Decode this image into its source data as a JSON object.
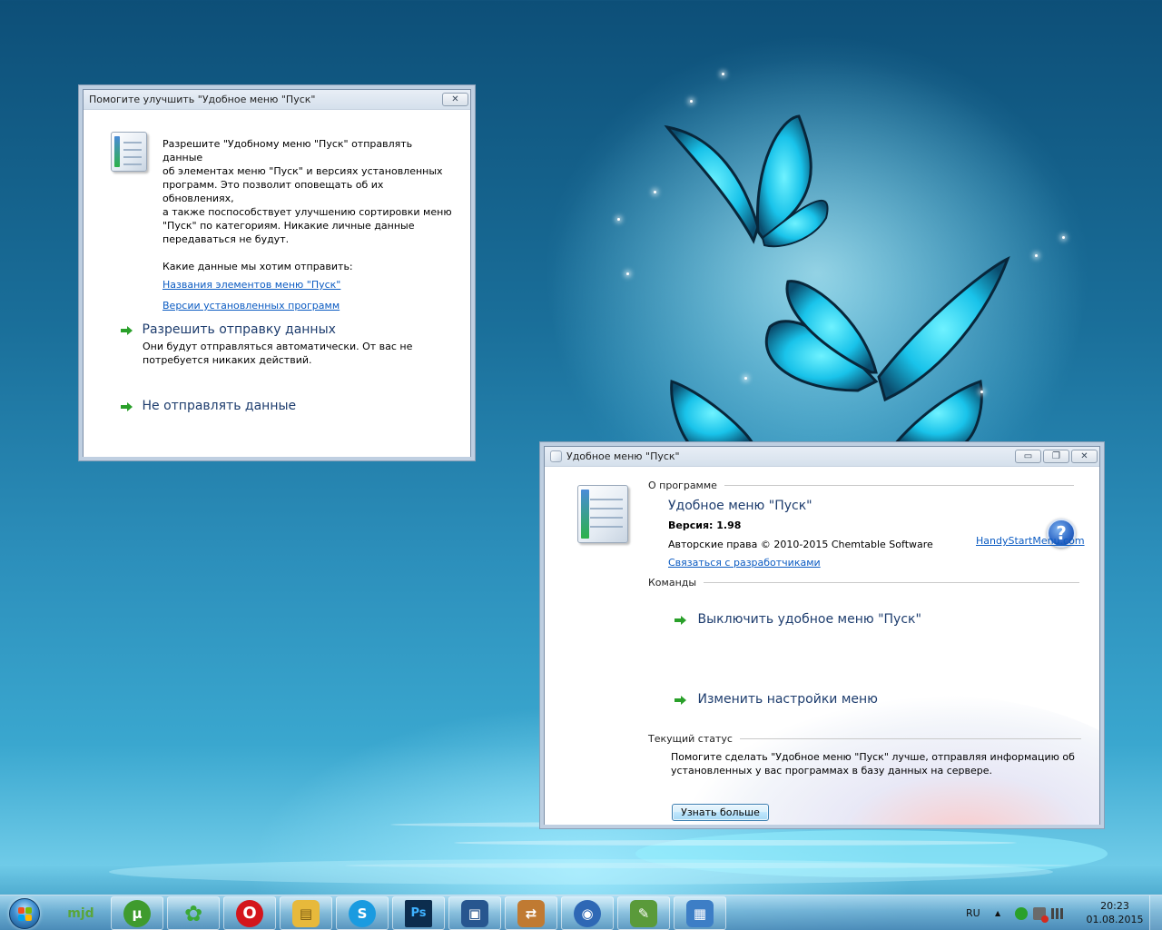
{
  "dialog1": {
    "title": "Помогите улучшить \"Удобное меню \"Пуск\"",
    "close_glyph": "✕",
    "intro_lines": [
      "Разрешите \"Удобному меню \"Пуск\" отправлять данные",
      "об элементах меню \"Пуск\" и версиях установленных",
      "программ. Это позволит оповещать об их обновлениях,",
      "а также поспособствует улучшению сортировки меню",
      "\"Пуск\" по категориям. Никакие личные данные",
      "передаваться не будут."
    ],
    "question": "Какие данные мы хотим отправить:",
    "link_items": "Названия элементов меню \"Пуск\"",
    "link_versions": "Версии установленных программ",
    "option_allow_title": "Разрешить отправку данных",
    "option_allow_desc_lines": [
      "Они будут отправляться автоматически. От вас не",
      "потребуется никаких действий."
    ],
    "option_deny_title": "Не отправлять данные"
  },
  "dialog2": {
    "title": "Удобное меню \"Пуск\"",
    "min_glyph": "▭",
    "max_glyph": "❐",
    "close_glyph": "✕",
    "section_about": "О программе",
    "app_name": "Удобное меню \"Пуск\"",
    "version": "Версия: 1.98",
    "copyright": "Авторские права © 2010-2015 Chemtable Software",
    "contact_link": "Связаться с разработчиками",
    "website_link": "HandyStartMenu.com",
    "help_glyph": "?",
    "section_commands": "Команды",
    "cmd_disable": "Выключить удобное меню \"Пуск\"",
    "cmd_settings": "Изменить настройки меню",
    "section_status": "Текущий статус",
    "status_lines": [
      "Помогите сделать \"Удобное меню \"Пуск\" лучше, отправляя информацию об",
      "установленных у вас программах в базу данных на сервере."
    ],
    "learn_more_button": "Узнать больше"
  },
  "taskbar": {
    "pinned": [
      {
        "name": "mjd",
        "label": "mjd",
        "color": "#5aa63a"
      },
      {
        "name": "utorrent",
        "label": "μ",
        "color": "#3f9b2e"
      },
      {
        "name": "icq",
        "label": "✿",
        "color": "#3aa836"
      },
      {
        "name": "opera",
        "label": "O",
        "color": "#d4151c"
      },
      {
        "name": "file-explorer",
        "label": "▤",
        "color": "#e7b93b"
      },
      {
        "name": "skype",
        "label": "S",
        "color": "#1a9be0"
      },
      {
        "name": "photoshop",
        "label": "Ps",
        "color": "#0c2d4e"
      },
      {
        "name": "virtualbox",
        "label": "▣",
        "color": "#27568f"
      },
      {
        "name": "network-app",
        "label": "⇄",
        "color": "#c07a32"
      },
      {
        "name": "search-app",
        "label": "◉",
        "color": "#2e68b5"
      },
      {
        "name": "tool-app",
        "label": "✎",
        "color": "#5a9a3a"
      },
      {
        "name": "handy-start-menu",
        "label": "▦",
        "color": "#3d7ec6"
      }
    ],
    "language": "RU",
    "tray_up_glyph": "▲",
    "clock_time": "20:23",
    "clock_date": "01.08.2015"
  }
}
